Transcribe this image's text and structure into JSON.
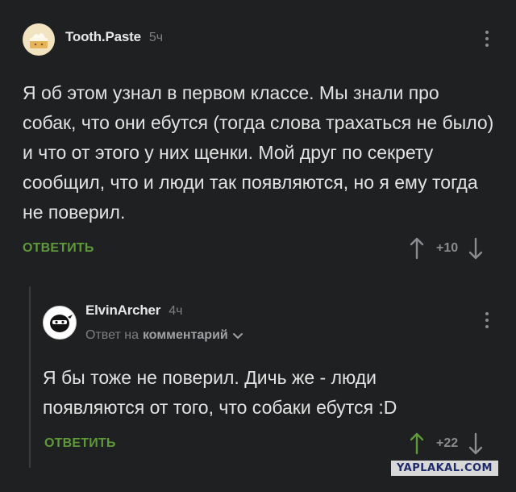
{
  "comments": [
    {
      "username": "Tooth.Paste",
      "time": "5ч",
      "avatar_icon": "cake-avatar-icon",
      "text": "Я об этом узнал в первом классе. Мы знали про собак, что они ебутся (тогда слова трахаться не было) и что от этого у них щенки. Мой друг по секрету сообщил, что и люди так появляются, но я ему тогда не поверил.",
      "reply_label": "ОТВЕТИТЬ",
      "score": "+10"
    },
    {
      "username": "ElvinArcher",
      "time": "4ч",
      "avatar_icon": "ninja-avatar-icon",
      "reply_to_prefix": "Ответ на",
      "reply_to_link": "комментарий",
      "text": "Я бы тоже не поверил. Дичь же - люди появляются от того, что собаки ебутся :D",
      "reply_label": "ОТВЕТИТЬ",
      "score": "+22",
      "upvoted": true
    }
  ],
  "colors": {
    "background": "#1f2021",
    "accent_green": "#5f9a3a",
    "muted": "#7d7f82"
  },
  "watermark": "YAPLAKAL.COM"
}
